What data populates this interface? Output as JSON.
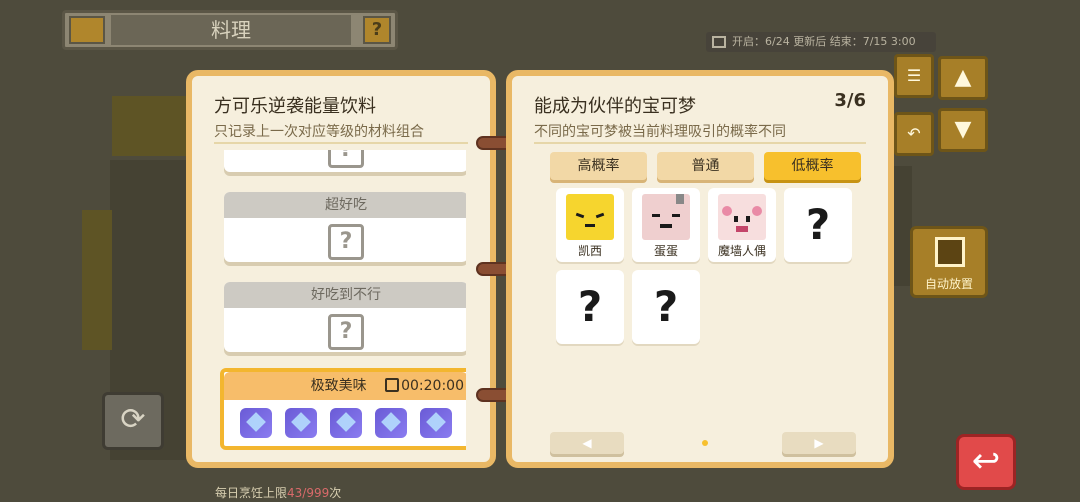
{
  "header": {
    "title": "料理",
    "help_icon": "question-icon"
  },
  "event": {
    "text": "开启：6/24  更新后 结束：7/15 3:00"
  },
  "left_page": {
    "title": "方可乐逆袭能量饮料",
    "subtitle": "只记录上一次对应等级的材料组合",
    "levels": [
      {
        "label": "超好吃"
      },
      {
        "label": "好吃到不行"
      },
      {
        "label": "极致美味",
        "timer": "00:20:00"
      }
    ]
  },
  "right_page": {
    "title": "能成为伙伴的宝可梦",
    "page_num": "3/6",
    "subtitle": "不同的宝可梦被当前料理吸引的概率不同",
    "tabs": [
      "高概率",
      "普通",
      "低概率"
    ],
    "active_tab": 2,
    "pokemon": [
      {
        "name": "凯西"
      },
      {
        "name": "蛋蛋"
      },
      {
        "name": "魔墙人偶"
      },
      {
        "name": ""
      },
      {
        "name": ""
      },
      {
        "name": ""
      }
    ],
    "prev_label": "◀",
    "next_label": "▶"
  },
  "side": {
    "auto_place": "自动放置"
  },
  "footer": {
    "limit_prefix": "每日烹饪上限",
    "limit_value": "43/999",
    "limit_suffix": "次"
  },
  "colors": {
    "accent": "#f7c02d",
    "page_border": "#e9b865",
    "back_button": "#e14a4a"
  }
}
